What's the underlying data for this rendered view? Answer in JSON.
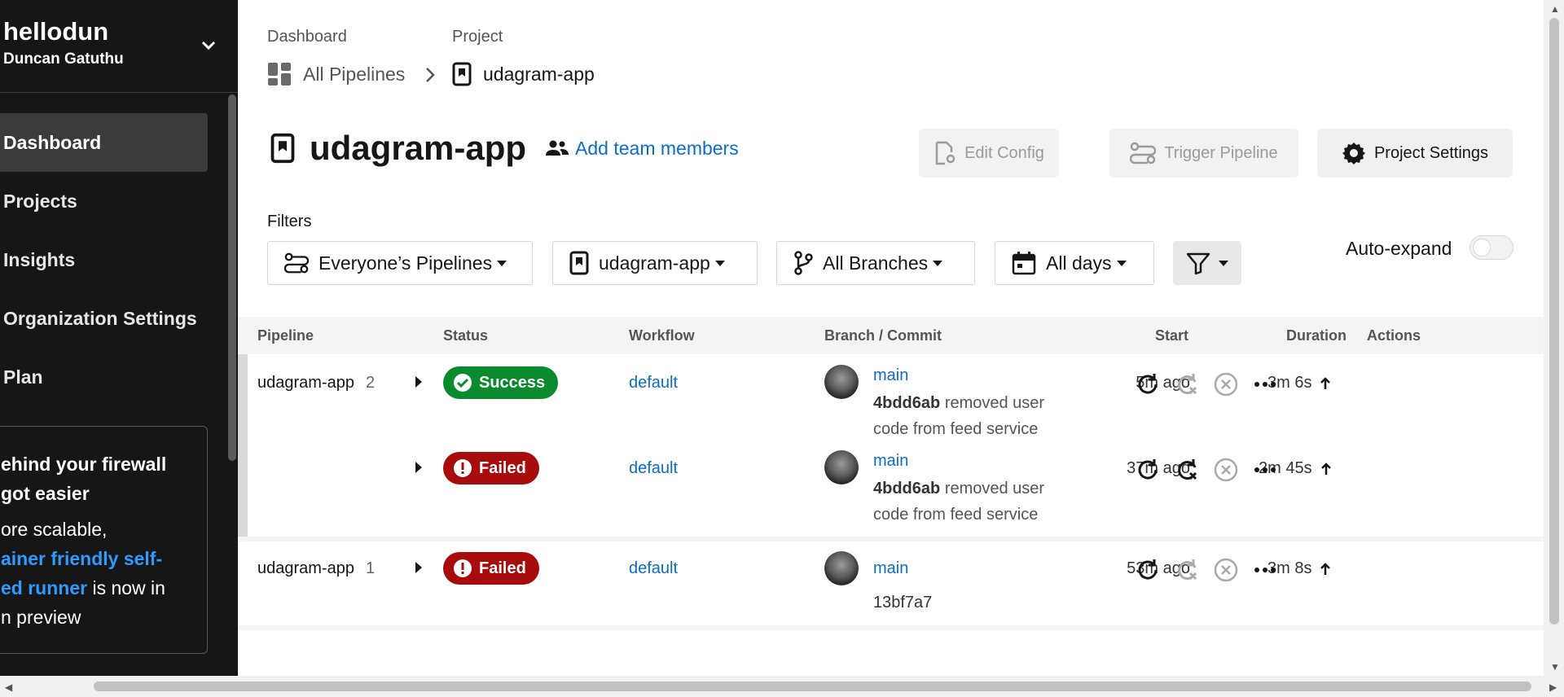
{
  "sidebar": {
    "org_name": "hellodun",
    "user_name": "Duncan Gatuthu",
    "items": [
      {
        "label": "Dashboard",
        "active": true
      },
      {
        "label": "Projects"
      },
      {
        "label": "Insights"
      },
      {
        "label": "Organization Settings"
      },
      {
        "label": "Plan"
      }
    ],
    "promo": {
      "title": "ehind your firewall\ngot easier",
      "body_prefix": "ore scalable,",
      "link": "ainer friendly self-\ned runner",
      "body_suffix": " is now in\nn preview"
    }
  },
  "breadcrumb": {
    "dashboard_label": "Dashboard",
    "project_label": "Project",
    "all_pipelines": "All Pipelines",
    "project_name": "udagram-app"
  },
  "header": {
    "title": "udagram-app",
    "add_team": "Add team members",
    "edit_config": "Edit Config",
    "trigger_pipeline": "Trigger Pipeline",
    "project_settings": "Project Settings"
  },
  "filters": {
    "label": "Filters",
    "pipelines": "Everyone’s Pipelines",
    "project": "udagram-app",
    "branches": "All Branches",
    "days": "All days",
    "auto_expand": "Auto-expand",
    "auto_expand_on": false
  },
  "table": {
    "headers": {
      "pipeline": "Pipeline",
      "status": "Status",
      "workflow": "Workflow",
      "branch_commit": "Branch / Commit",
      "start": "Start",
      "duration": "Duration",
      "actions": "Actions"
    },
    "rows": [
      {
        "pipeline": "udagram-app",
        "number": "2",
        "status": "Success",
        "workflow": "default",
        "branch": "main",
        "commit": "4bdd6ab",
        "message_1": "removed user",
        "message_2": "code from feed service",
        "start": "5m ago",
        "duration": "3m 6s"
      },
      {
        "pipeline": "",
        "number": "",
        "status": "Failed",
        "workflow": "default",
        "branch": "main",
        "commit": "4bdd6ab",
        "message_1": "removed user",
        "message_2": "code from feed service",
        "start": "37m ago",
        "duration": "2m 45s"
      },
      {
        "pipeline": "udagram-app",
        "number": "1",
        "status": "Failed",
        "workflow": "default",
        "branch": "main",
        "commit": "13bf7a7",
        "message_1": "",
        "message_2": "",
        "start": "53m ago",
        "duration": "3m 8s"
      }
    ]
  },
  "colors": {
    "success": "#0a8a2e",
    "failed": "#a80b0b",
    "link": "#0b6dc9",
    "sidebar_bg": "#161616"
  }
}
